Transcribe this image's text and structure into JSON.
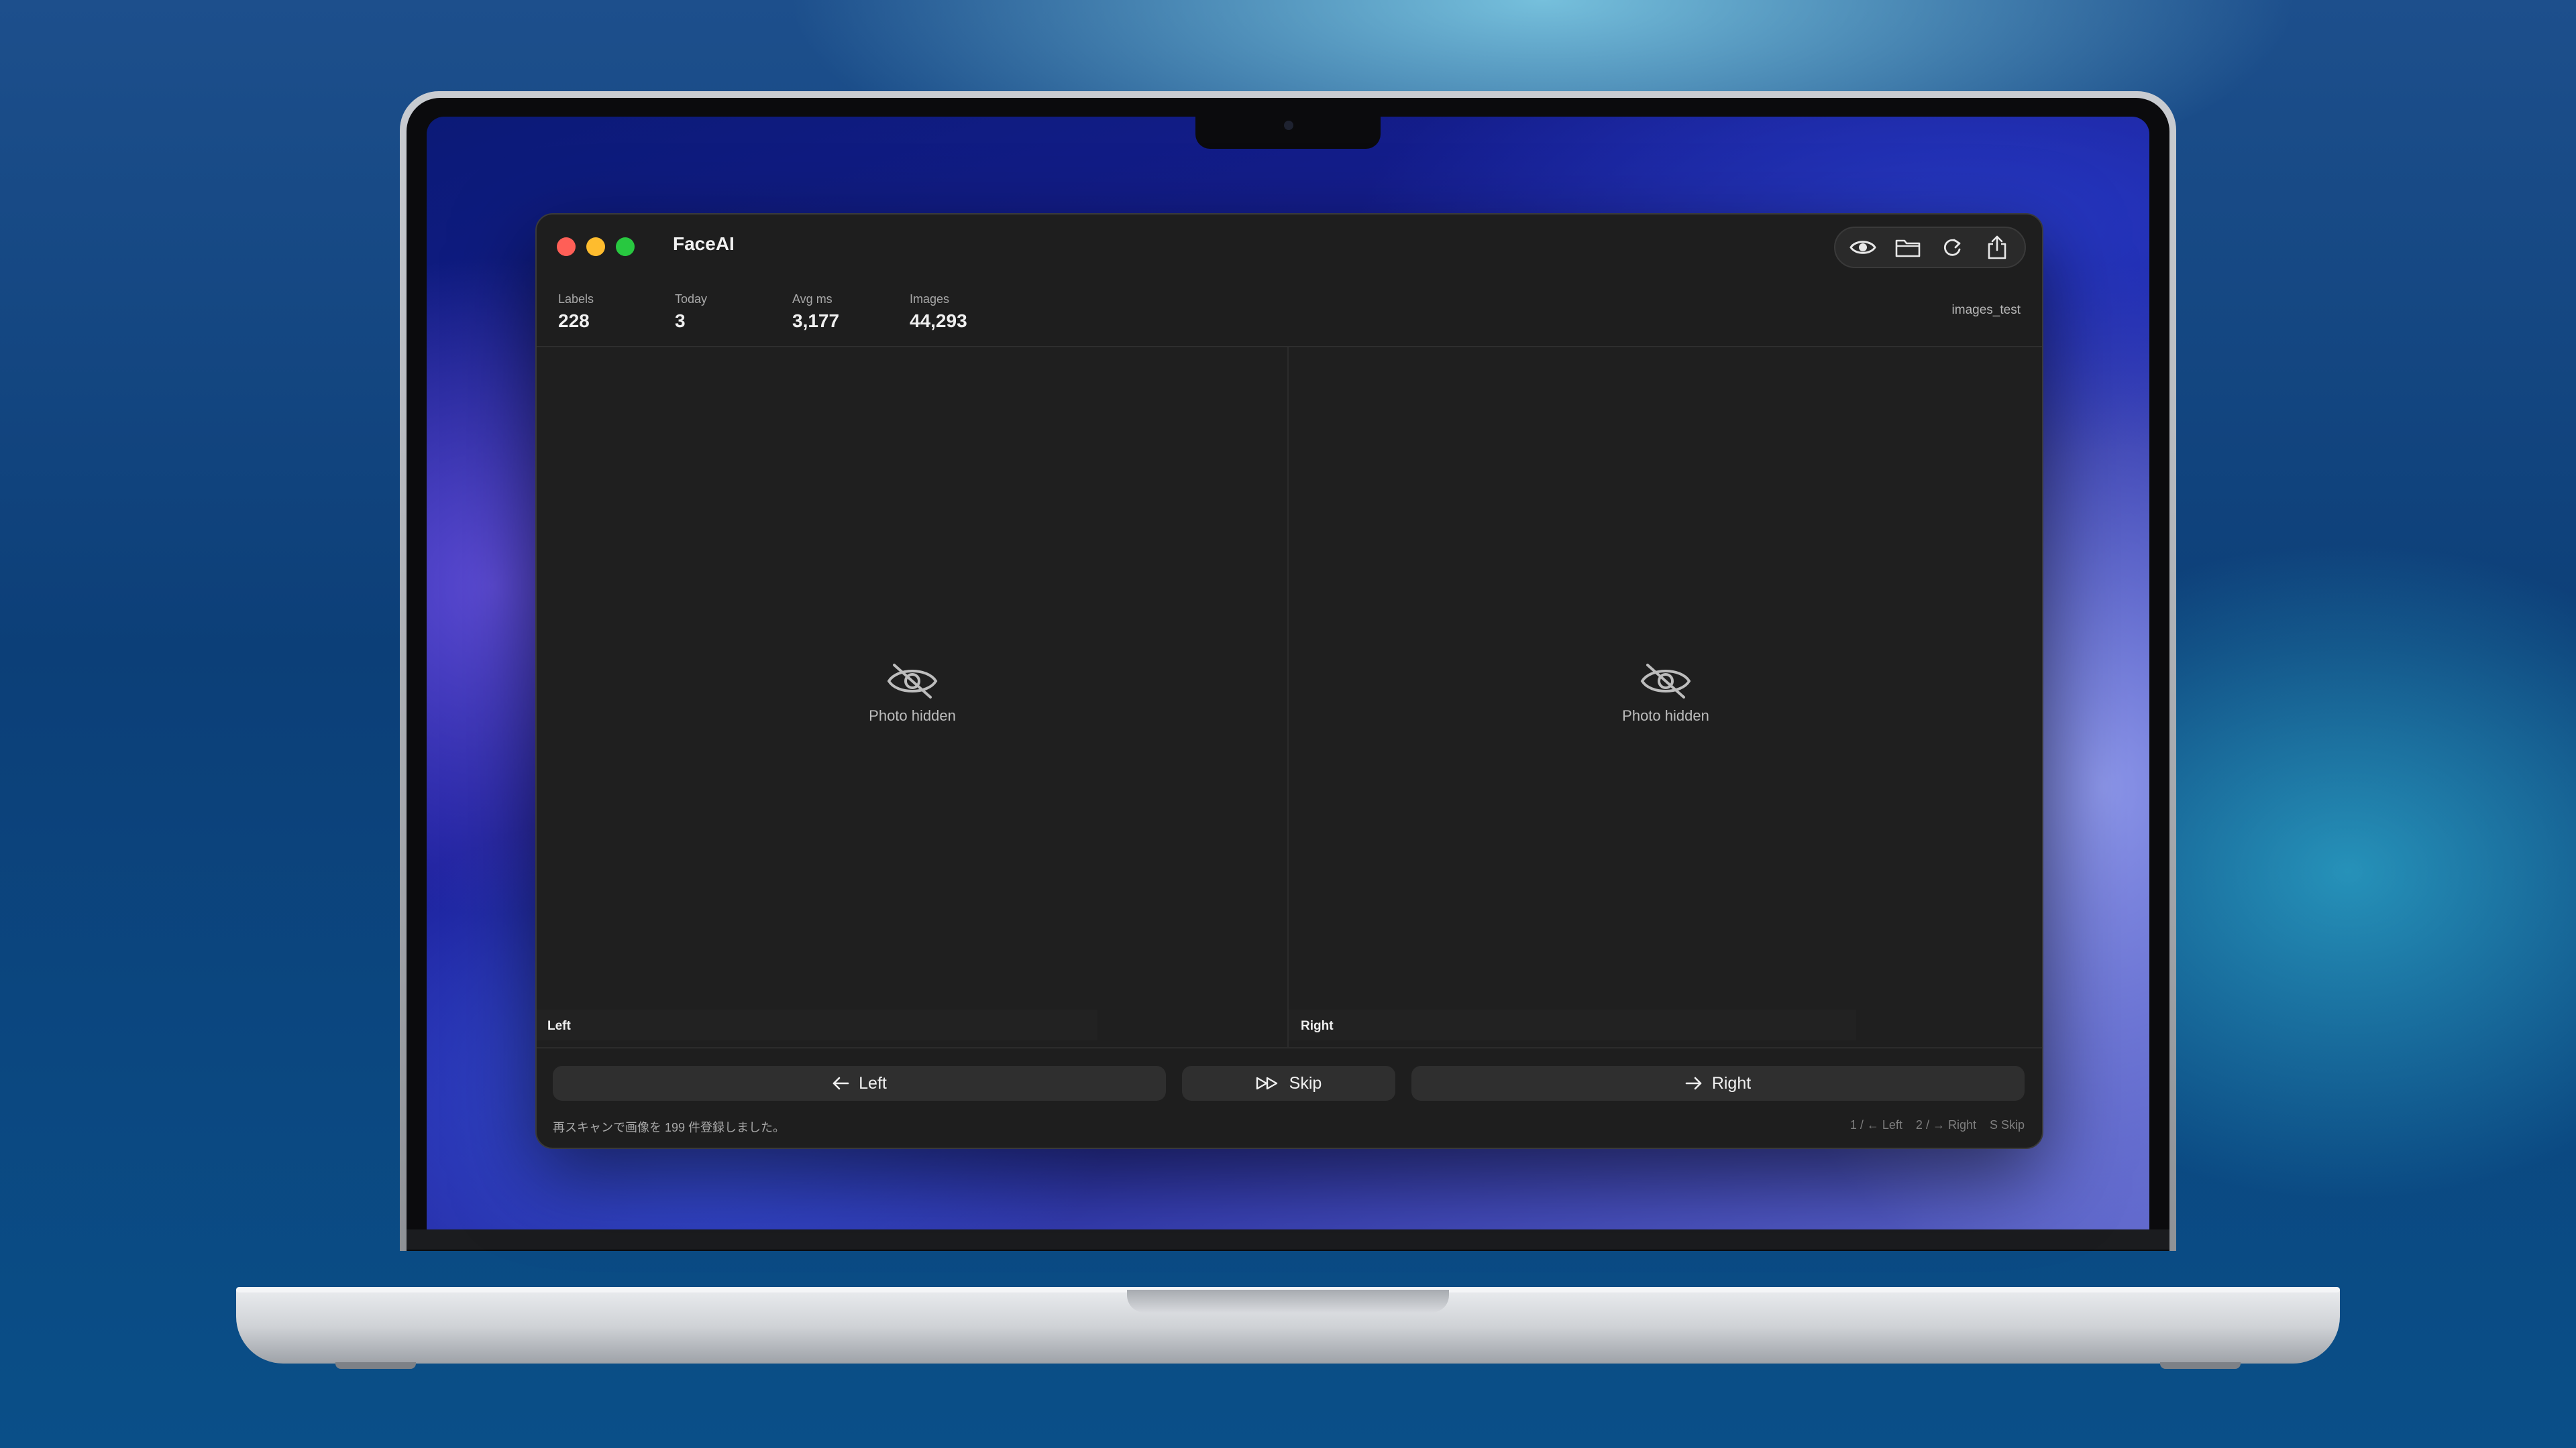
{
  "app": {
    "title": "FaceAI"
  },
  "toolbar": {
    "icons": [
      "eye-icon",
      "folder-icon",
      "refresh-icon",
      "share-icon"
    ]
  },
  "stats": [
    {
      "label": "Labels",
      "value": "228"
    },
    {
      "label": "Today",
      "value": "3"
    },
    {
      "label": "Avg ms",
      "value": "3,177"
    },
    {
      "label": "Images",
      "value": "44,293"
    }
  ],
  "folder_name": "images_test",
  "panes": {
    "left": {
      "placeholder": "Photo hidden",
      "label": "Left"
    },
    "right": {
      "placeholder": "Photo hidden",
      "label": "Right"
    }
  },
  "actions": {
    "left_label": "Left",
    "skip_label": "Skip",
    "right_label": "Right"
  },
  "status_message": "再スキャンで画像を 199 件登録しました。",
  "shortcut_hints": "1 / ← Left    2 / → Right    S Skip",
  "colors": {
    "close": "#ff5f57",
    "minimize": "#febc2e",
    "zoom": "#28c840",
    "window_bg": "#1e1e1e"
  }
}
